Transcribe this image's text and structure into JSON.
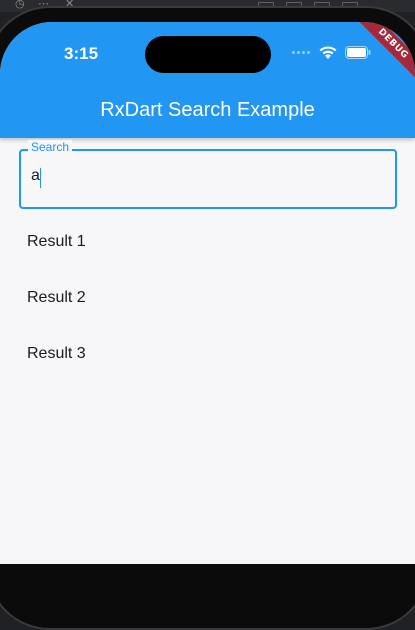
{
  "status_bar": {
    "time": "3:15"
  },
  "debug_banner": "DEBUG",
  "app_bar": {
    "title": "RxDart Search Example"
  },
  "search": {
    "label": "Search",
    "value": "a"
  },
  "results": [
    {
      "label": "Result 1"
    },
    {
      "label": "Result 2"
    },
    {
      "label": "Result 3"
    }
  ],
  "colors": {
    "accent": "#2196f3",
    "background": "#f7f6f8",
    "debug_banner": "#a6283a"
  }
}
